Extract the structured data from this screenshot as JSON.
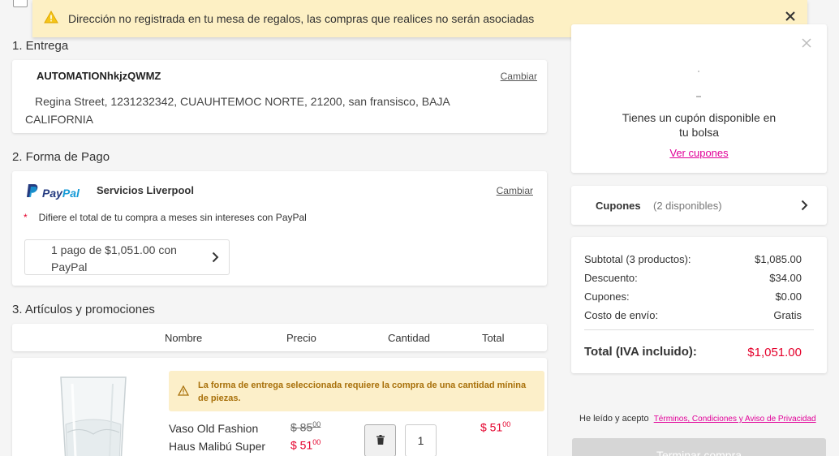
{
  "banner": {
    "message": "Dirección no registrada en tu mesa de regalos, las compras que realices no serán asociadas",
    "close_icon": "close-icon",
    "warning_icon": "warning-icon"
  },
  "delivery": {
    "section_title": "1. Entrega",
    "name": "AUTOMATIONhkjzQWMZ",
    "change_label": "Cambiar",
    "address": "Regina Street, 1231232342, CUAUHTEMOC NORTE, 21200, san fransisco, BAJA CALIFORNIA"
  },
  "payment": {
    "section_title": "2. Forma de Pago",
    "paypal_pay": "Pay",
    "paypal_pal": "Pal",
    "method_name": "Servicios Liverpool",
    "change_label": "Cambiar",
    "asterisk": "*",
    "note": "Difiere el total de tu compra a meses sin intereses con PayPal",
    "installment_label": "1 pago de $1,051.00 con PayPal"
  },
  "items": {
    "section_title": "3. Artículos y promociones",
    "headers": [
      "Nombre",
      "Precio",
      "Cantidad",
      "Total"
    ],
    "warning": "La forma de entrega seleccionada requiere la compra de una cantidad mínina de piezas.",
    "product": {
      "name": "Vaso Old Fashion Haus Malibú Super",
      "old_price_int": "$ 85",
      "old_price_dec": "00",
      "price_int": "$ 51",
      "price_dec": "00",
      "quantity": "1",
      "total_int": "$ 51",
      "total_dec": "00"
    }
  },
  "coupon_card": {
    "message": "Tienes un cupón disponible en tu bolsa",
    "link": "Ver cupones"
  },
  "coupons_row": {
    "label": "Cupones",
    "count": "(2 disponibles)"
  },
  "summary": {
    "rows": [
      {
        "label": "Subtotal (3 productos):",
        "value": "$1,085.00"
      },
      {
        "label": "Descuento:",
        "value": "$34.00"
      },
      {
        "label": "Cupones:",
        "value": "$0.00"
      },
      {
        "label": "Costo de envío:",
        "value": "Gratis"
      }
    ],
    "total_label": "Total (IVA incluido):",
    "total_value": "$1,051.00"
  },
  "terms": {
    "prefix": "He leído y acepto",
    "link": "Términos, Condiciones y Aviso de Privacidad"
  },
  "checkout_button": "Terminar compra",
  "colors": {
    "accent": "#e10098",
    "price_red": "#e4002b",
    "banner_bg": "#fdf0c4",
    "warning_bg": "#fcefc9",
    "warning_text": "#a8700a",
    "paypal_dark": "#253b80",
    "paypal_light": "#179bd7"
  }
}
